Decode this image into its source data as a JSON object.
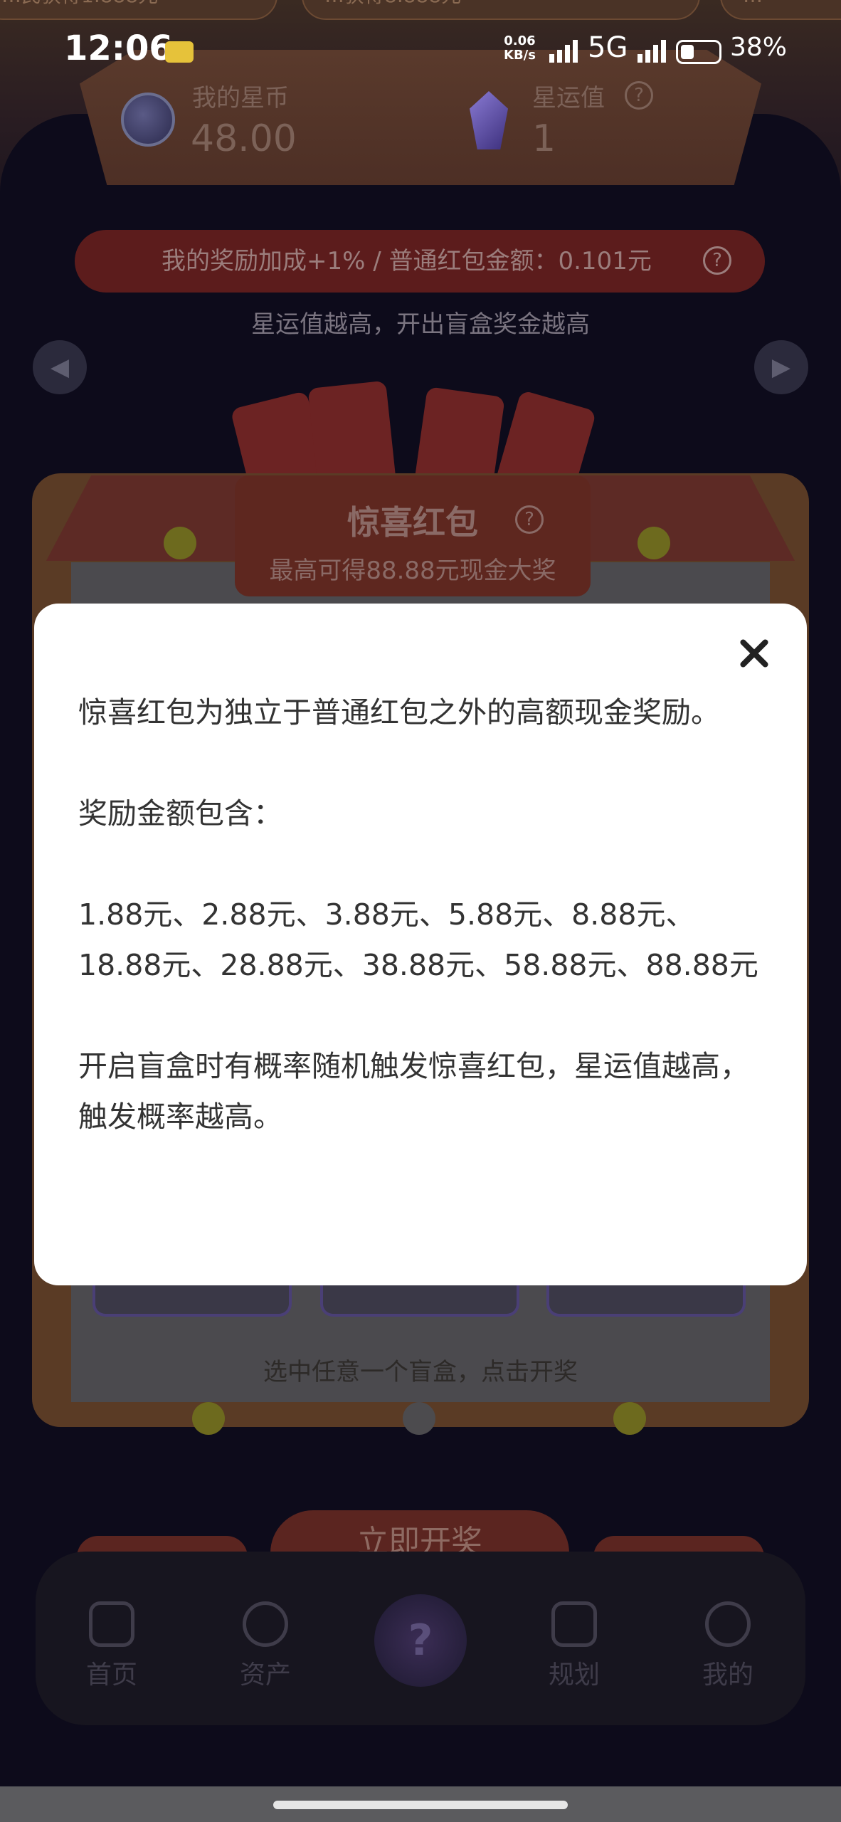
{
  "status_bar": {
    "time": "12:06",
    "net_speed_value": "0.06",
    "net_speed_unit": "KB/s",
    "network": "5G",
    "battery": "38%"
  },
  "ticker": {
    "items": [
      "…民获得1.888元",
      "…获得8.888元",
      "…"
    ]
  },
  "header": {
    "coins_label": "我的星币",
    "coins_value": "48.00",
    "star_label": "星运值",
    "star_value": "1",
    "help_glyph": "?"
  },
  "bonus_bar": {
    "text": "我的奖励加成+1% / 普通红包金额：0.101元"
  },
  "subtitle": "星运值越高，开出盲盒奖金越高",
  "nav_arrows": {
    "prev": "◀",
    "next": "▶"
  },
  "sign": {
    "title": "惊喜红包",
    "subtitle": "最高可得88.88元现金大奖"
  },
  "choose_text": "选中任意一个盲盒，点击开奖",
  "open_button": "立即开奖",
  "bottom_nav": {
    "items": [
      {
        "label": "首页",
        "icon": "home-icon"
      },
      {
        "label": "资产",
        "icon": "diamond-icon"
      },
      {
        "label": "?",
        "icon": "mystery-box-icon"
      },
      {
        "label": "规划",
        "icon": "star-book-icon"
      },
      {
        "label": "我的",
        "icon": "person-icon"
      }
    ]
  },
  "dialog": {
    "paragraphs": [
      "惊喜红包为独立于普通红包之外的高额现金奖励。",
      "奖励金额包含：",
      "1.88元、2.88元、3.88元、5.88元、8.88元、18.88元、28.88元、38.88元、58.88元、88.88元",
      "开启盲盒时有概率随机触发惊喜红包，星运值越高，触发概率越高。"
    ],
    "close_icon": "close-icon"
  },
  "colors": {
    "overlay_dim": "#0b0a16",
    "dialog_bg": "#ffffff",
    "dialog_text": "#333333",
    "accent_red": "#e0483f"
  }
}
